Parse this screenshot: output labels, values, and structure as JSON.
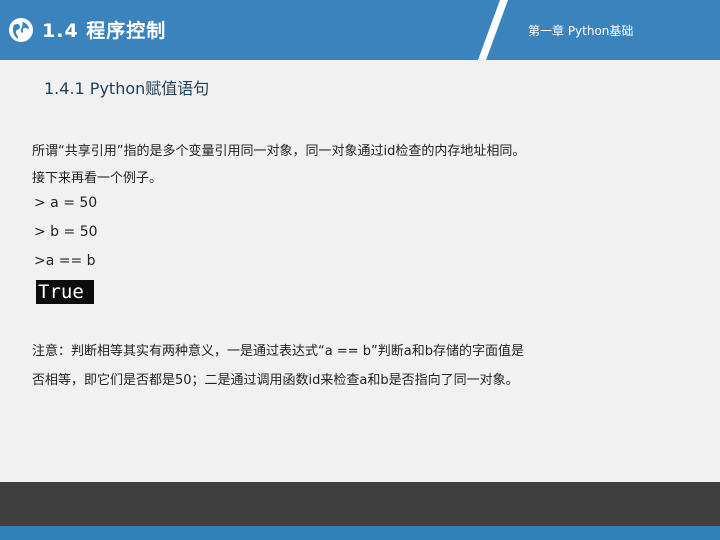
{
  "header": {
    "section_title": "1.4 程序控制",
    "chapter_label": "第一章 Python基础",
    "accent_color": "#3b83bd",
    "icon": "globe-icon"
  },
  "subsection_title": "1.4.1 Python赋值语句",
  "paragraphs": {
    "intro_line1": "所谓“共享引用”指的是多个变量引用同一对象，同一对象通过id检查的内存地址相同。",
    "intro_line2": "接下来再看一个例子。",
    "note_line1": "注意：判断相等其实有两种意义，一是通过表达式“a == b”判断a和b存储的字面值是",
    "note_line2": "否相等，即它们是否都是50；二是通过调用函数id来检查a和b是否指向了同一对象。"
  },
  "code": {
    "line1": "> a = 50",
    "line2": "> b = 50",
    "line3": ">a == b",
    "output": "True"
  },
  "footer": {
    "dark_color": "#3f3f3f",
    "blue_color": "#2f7fb8"
  }
}
